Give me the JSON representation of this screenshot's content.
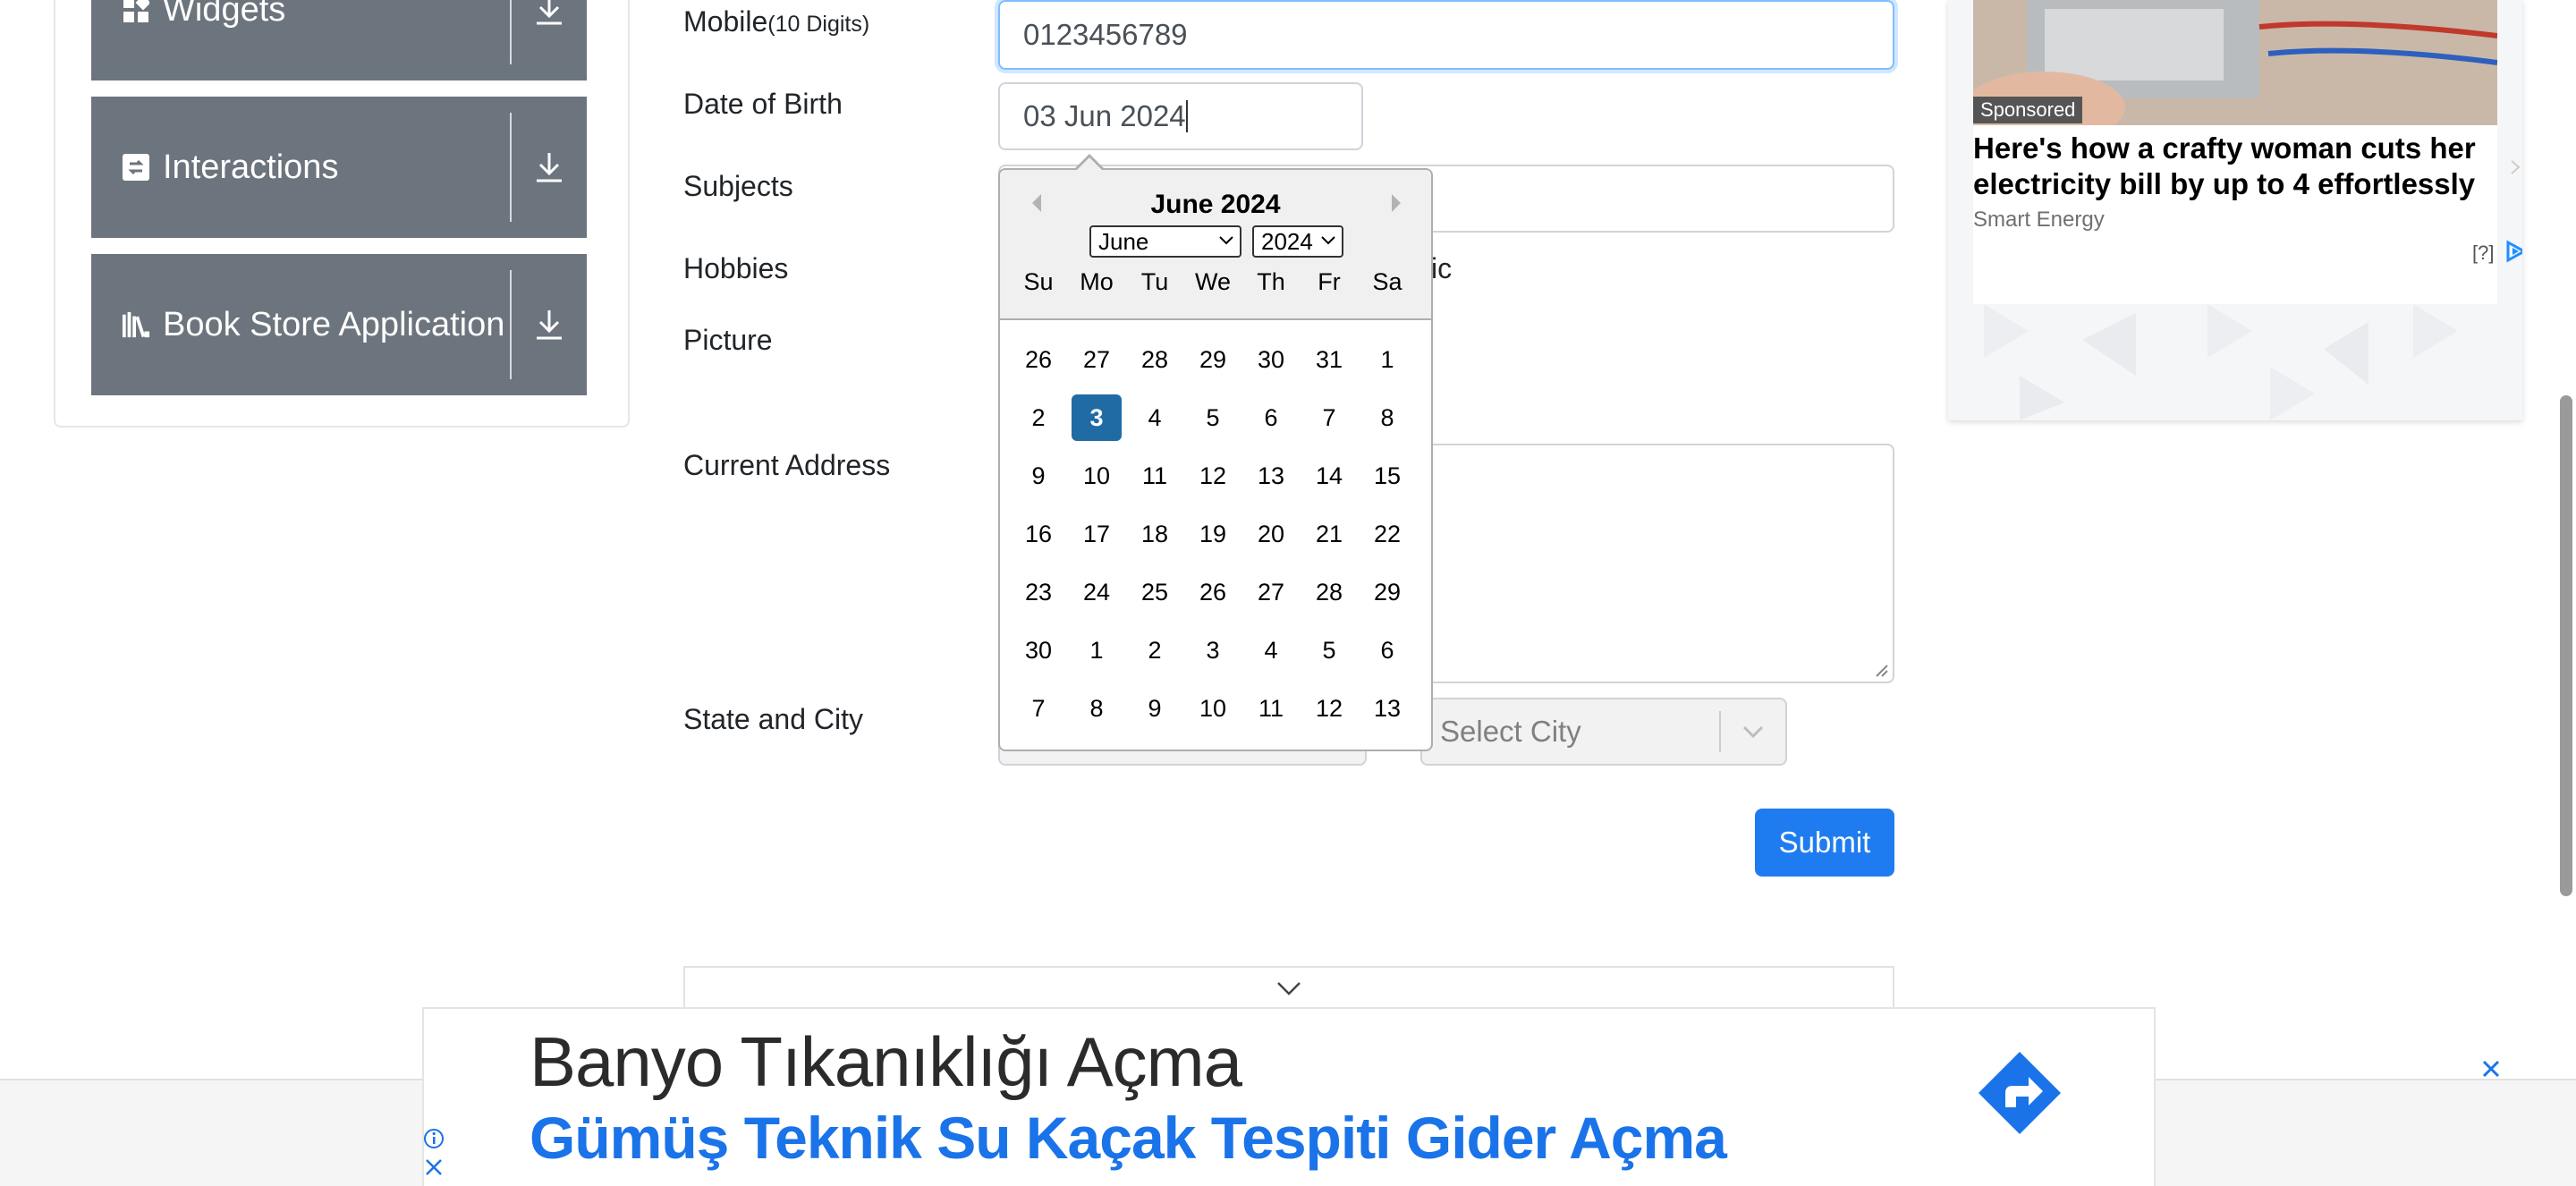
{
  "sidebar": {
    "groups": [
      {
        "label": "Widgets",
        "icon": "widgets-icon"
      },
      {
        "label": "Interactions",
        "icon": "interactions-icon"
      },
      {
        "label": "Book Store Application",
        "icon": "book-store-icon"
      }
    ]
  },
  "form": {
    "mobile": {
      "label": "Mobile",
      "hint": "(10 Digits)",
      "value": "0123456789"
    },
    "dob": {
      "label": "Date of Birth",
      "value": "03 Jun 2024"
    },
    "subjects": {
      "label": "Subjects"
    },
    "hobbies": {
      "label": "Hobbies",
      "partial_text": "ic"
    },
    "picture": {
      "label": "Picture"
    },
    "address": {
      "label": "Current Address"
    },
    "state_city": {
      "label": "State and City",
      "city_placeholder": "Select City"
    },
    "submit_label": "Submit"
  },
  "datepicker": {
    "title": "June 2024",
    "month_select": "June",
    "year_select": "2024",
    "day_names": [
      "Su",
      "Mo",
      "Tu",
      "We",
      "Th",
      "Fr",
      "Sa"
    ],
    "weeks": [
      [
        "26",
        "27",
        "28",
        "29",
        "30",
        "31",
        "1"
      ],
      [
        "2",
        "3",
        "4",
        "5",
        "6",
        "7",
        "8"
      ],
      [
        "9",
        "10",
        "11",
        "12",
        "13",
        "14",
        "15"
      ],
      [
        "16",
        "17",
        "18",
        "19",
        "20",
        "21",
        "22"
      ],
      [
        "23",
        "24",
        "25",
        "26",
        "27",
        "28",
        "29"
      ],
      [
        "30",
        "1",
        "2",
        "3",
        "4",
        "5",
        "6"
      ],
      [
        "7",
        "8",
        "9",
        "10",
        "11",
        "12",
        "13"
      ]
    ],
    "selected_day": "3"
  },
  "ad_right": {
    "sponsored": "Sponsored",
    "headline": "Here's how a crafty woman cuts her electricity bill by up to 4 effortlessly",
    "source": "Smart Energy",
    "question": "[?]"
  },
  "banner": {
    "title": "Banyo Tıkanıklığı Açma",
    "subtitle": "Gümüş Teknik Su Kaçak Tespiti Gider Açma"
  },
  "colors": {
    "sidebar_group": "#6c757d",
    "submit": "#1f7cf0",
    "selected_day": "#216ba5",
    "banner_link": "#1a73e8"
  }
}
